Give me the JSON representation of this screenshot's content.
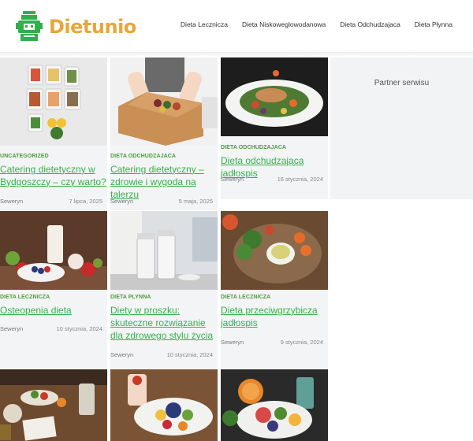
{
  "header": {
    "logo_text": "Dietunio",
    "nav": [
      "Dieta Lecznicza",
      "Dieta Niskoweglowodanowa",
      "Dieta Odchudzajaca",
      "Dieta Płynna"
    ]
  },
  "sidebar": {
    "title": "Partner serwisu"
  },
  "posts": [
    {
      "category": "UNCATEGORIZED",
      "title": "Catering dietetyczny w Bydgoszczy – czy warto?",
      "author": "Seweryn",
      "date": "7 lipca, 2025",
      "image": "meal-prep-boxes"
    },
    {
      "category": "DIETA ODCHUDZAJACA",
      "title": "Catering dietetyczny – zdrowie i wygoda na talerzu",
      "author": "Seweryn",
      "date": "5 maja, 2025",
      "image": "delivery-box"
    },
    {
      "category": "DIETA ODCHUDZAJACA",
      "title": "Dieta odchudzająca jadłospis",
      "author": "Seweryn",
      "date": "16 stycznia, 2024",
      "image": "salad-plate"
    },
    {
      "category": "DIETA LECZNICZA",
      "title": "Osteopenia dieta",
      "author": "Seweryn",
      "date": "10 stycznia, 2024",
      "image": "berries-milk"
    },
    {
      "category": "DIETA PLYNNA",
      "title": "Diety w proszku: skuteczne rozwiązanie dla zdrowego stylu życia",
      "author": "Seweryn",
      "date": "10 stycznia, 2024",
      "image": "powder-jars"
    },
    {
      "category": "DIETA LECZNICZA",
      "title": "Dieta przeciwgrzybicza jadłospis",
      "author": "Seweryn",
      "date": "9 stycznia, 2024",
      "image": "veggie-dip"
    },
    {
      "category": "",
      "title": "",
      "author": "",
      "date": "",
      "image": "breakfast-table"
    },
    {
      "category": "",
      "title": "",
      "author": "",
      "date": "",
      "image": "fruit-bowl"
    },
    {
      "category": "",
      "title": "",
      "author": "",
      "date": "",
      "image": "citrus-plate"
    }
  ],
  "colors": {
    "accent": "#34b24a",
    "category": "#4c9a3a",
    "logo": "#e8a63a",
    "logo_icon": "#2fb04a"
  }
}
